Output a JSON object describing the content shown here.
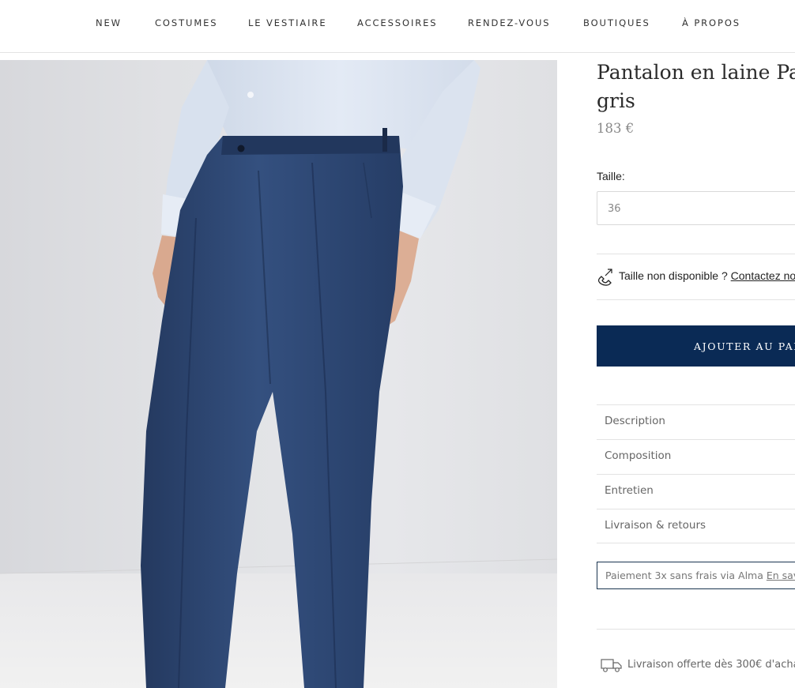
{
  "nav": {
    "items": [
      "NEW",
      "COSTUMES",
      "LE VESTIAIRE",
      "ACCESSOIRES",
      "RENDEZ-VOUS",
      "BOUTIQUES",
      "À PROPOS"
    ]
  },
  "product": {
    "title_line1": "Pantalon en laine Palon",
    "title_line2": "gris",
    "price": "183 €",
    "image_alt": "pantalon-bleu-marine-porte",
    "colors": {
      "trouser": "#2f4a79",
      "shirt": "#dde6f2",
      "button": "#0a2a55",
      "background": "#e2e3e6"
    }
  },
  "size": {
    "label": "Taille:",
    "selected": "36"
  },
  "unavailable": {
    "text": "Taille non disponible ? ",
    "link": "Contactez no",
    "icon": "phone-icon"
  },
  "cart": {
    "label": "AJOUTER AU PAN"
  },
  "accordion": [
    "Description",
    "Composition",
    "Entretien",
    "Livraison & retours"
  ],
  "payment": {
    "text": "Paiement 3x sans frais via Alma ",
    "link": "En sav"
  },
  "shipping": {
    "text": "Livraison offerte dès 300€ d'acha",
    "icon": "truck-icon"
  }
}
